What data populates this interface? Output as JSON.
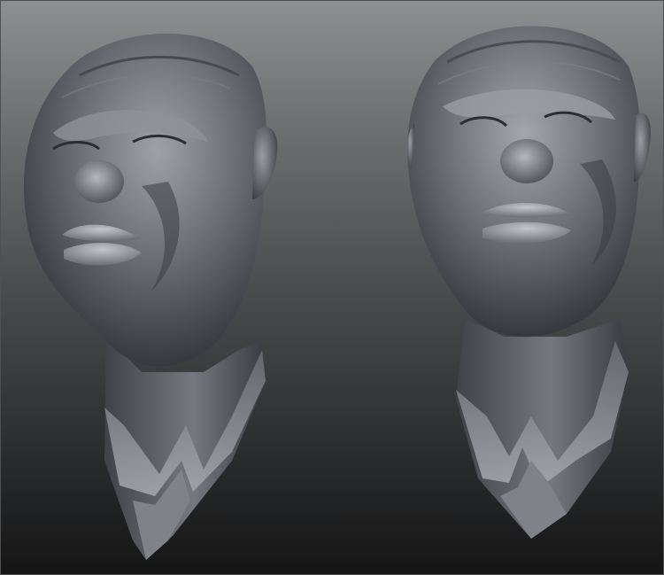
{
  "scene": {
    "background_top": "#8d8f91",
    "background_bottom": "#151516",
    "clay_base": "#5a5d63",
    "clay_highlight": "#c9ccd1",
    "clay_shadow": "#2a2b2e"
  },
  "views": [
    {
      "id": "bust-left"
    },
    {
      "id": "bust-right"
    }
  ]
}
